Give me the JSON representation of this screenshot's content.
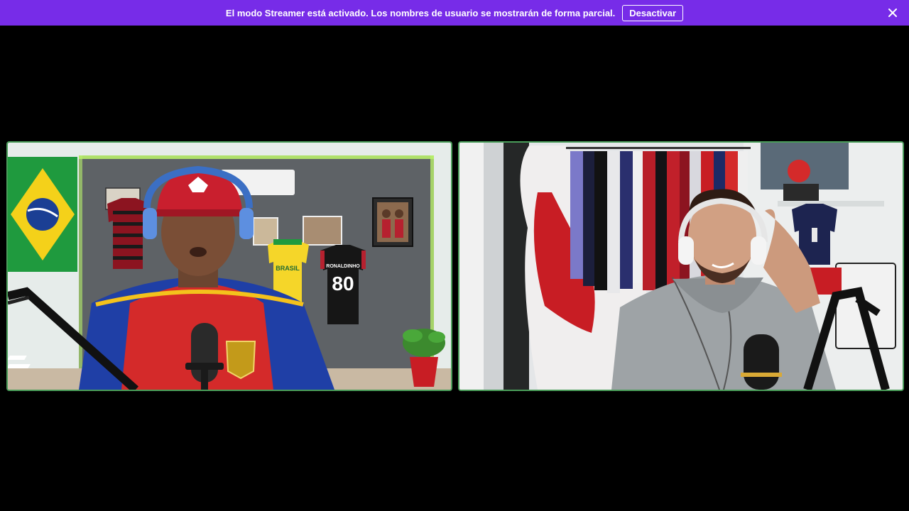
{
  "banner": {
    "message": "El modo Streamer está activado. Los nombres de usuario se mostrarán de forma parcial.",
    "deactivate_label": "Desactivar",
    "bg_color": "#772ce8"
  },
  "tiles": {
    "left": {
      "jersey_wall_name": "RONALDINHO",
      "jersey_wall_number": "80",
      "jersey_yellow_text": "BRASIL"
    }
  },
  "colors": {
    "active_border": "#4a9d5a",
    "background": "#000000"
  },
  "icons": {
    "close": "close-icon"
  }
}
